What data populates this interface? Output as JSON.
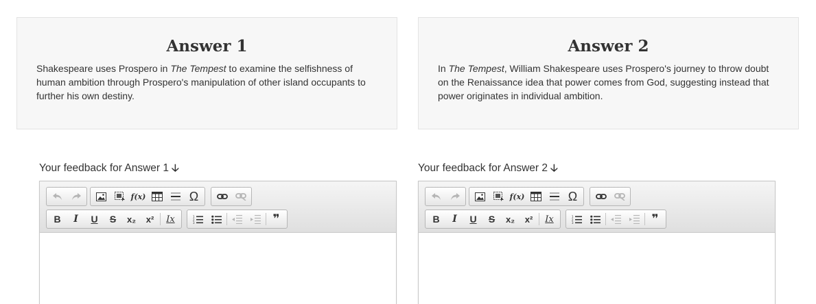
{
  "answers": [
    {
      "title": "Answer 1",
      "text_parts": [
        "Shakespeare uses Prospero in ",
        "The Tempest",
        " to examine the selfishness of human ambition through Prospero's manipulation of other island occupants to further his own destiny."
      ]
    },
    {
      "title": "Answer 2",
      "text_parts": [
        "In ",
        "The Tempest",
        ", William Shakespeare uses Prospero's journey to throw doubt on the Renaissance idea that power comes from God, suggesting instead that power originates in individual ambition."
      ]
    }
  ],
  "feedback": [
    {
      "label": "Your feedback for Answer 1"
    },
    {
      "label": "Your feedback for Answer 2"
    }
  ],
  "toolbar": {
    "formula_label": "f(x)",
    "omega_label": "Ω",
    "bold_label": "B",
    "italic_label": "I",
    "underline_label": "U",
    "strike_label": "S",
    "subscript_label": "x₂",
    "superscript_label": "x²",
    "remove_format_label": "Ix",
    "blockquote_label": "❞",
    "icons": [
      "undo-icon",
      "redo-icon",
      "image-icon",
      "flash-icon",
      "formula-icon",
      "table-icon",
      "horizontal-rule-icon",
      "special-char-icon",
      "link-icon",
      "unlink-icon",
      "bold-icon",
      "italic-icon",
      "underline-icon",
      "strikethrough-icon",
      "subscript-icon",
      "superscript-icon",
      "remove-format-icon",
      "numbered-list-icon",
      "bulleted-list-icon",
      "outdent-icon",
      "indent-icon",
      "blockquote-icon"
    ]
  },
  "colors": {
    "card_bg": "#f7f7f7",
    "card_border": "#e3e3e3",
    "text": "#333333",
    "disabled": "#b5b5b5"
  }
}
